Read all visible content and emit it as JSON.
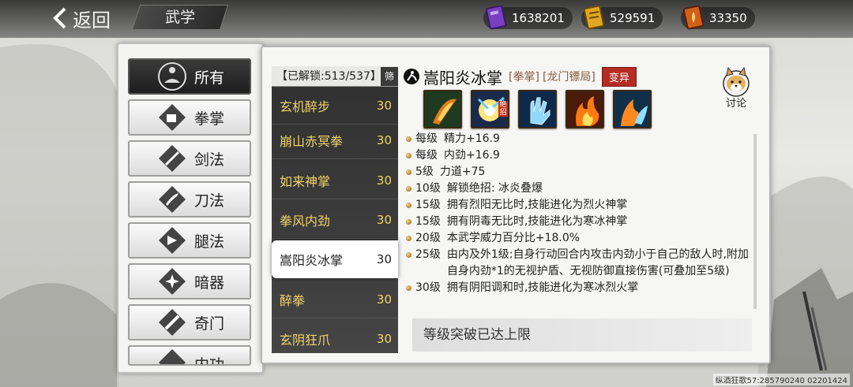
{
  "header": {
    "back_label": "返回",
    "section_title": "武学",
    "currencies": [
      {
        "icon": "purple-book-icon",
        "value": "1638201",
        "color": "#7a3fc0"
      },
      {
        "icon": "gold-scroll-icon",
        "value": "529591",
        "color": "#e0a820"
      },
      {
        "icon": "orange-scroll-icon",
        "value": "33350",
        "color": "#d0601a"
      }
    ]
  },
  "categories": [
    {
      "label": "所有",
      "icon": "meditation-icon",
      "active": true
    },
    {
      "label": "拳掌",
      "icon": "fist-icon",
      "active": false
    },
    {
      "label": "剑法",
      "icon": "sword-icon",
      "active": false
    },
    {
      "label": "刀法",
      "icon": "blade-icon",
      "active": false
    },
    {
      "label": "腿法",
      "icon": "kick-icon",
      "active": false
    },
    {
      "label": "暗器",
      "icon": "shuriken-icon",
      "active": false
    },
    {
      "label": "奇门",
      "icon": "staff-icon",
      "active": false
    },
    {
      "label": "内功",
      "icon": "inner-power-icon",
      "active": false
    }
  ],
  "skill_list": {
    "unlock_label": "【已解锁:513/537】",
    "filter_label": "筛",
    "items": [
      {
        "name": "玄机醉步",
        "level": "30"
      },
      {
        "name": "崩山赤冥拳",
        "level": "30"
      },
      {
        "name": "如来神掌",
        "level": "30"
      },
      {
        "name": "拳风内劲",
        "level": "30"
      },
      {
        "name": "嵩阳炎冰掌",
        "level": "30",
        "selected": true
      },
      {
        "name": "醉拳",
        "level": "30"
      },
      {
        "name": "玄阴狂爪",
        "level": "30"
      }
    ]
  },
  "detail": {
    "name": "嵩阳炎冰掌",
    "tag_type": "[拳掌]",
    "tag_source": "[龙门镖局]",
    "badge": "变异",
    "discuss_label": "讨论",
    "icons": [
      "fire-fist-icon",
      "ultimate-burst-icon",
      "ice-palm-icon",
      "flame-fist-icon",
      "fire-ice-icon"
    ],
    "ultimate_mark": "绝招",
    "effects": [
      {
        "level": "每级",
        "text": "精力+16.9"
      },
      {
        "level": "每级",
        "text": "内劲+16.9"
      },
      {
        "level": "5级",
        "text": "力道+75"
      },
      {
        "level": "10级",
        "text": "解锁绝招:  冰炎叠爆"
      },
      {
        "level": "15级",
        "text": "拥有烈阳无比时,技能进化为烈火神掌"
      },
      {
        "level": "15级",
        "text": "拥有阴毒无比时,技能进化为寒冰神掌"
      },
      {
        "level": "20级",
        "text": "本武学威力百分比+18.0%"
      },
      {
        "level": "25级",
        "text": "由内及外1级:自身行动回合内攻击内劲小于自己的敌人时,附加自身内劲*1的无视护盾、无视防御直接伤害(可叠加至5级)"
      },
      {
        "level": "30级",
        "text": "拥有阴阳调和时,技能进化为寒冰烈火掌"
      }
    ],
    "limit_text": "等级突破已达上限"
  },
  "watermark": "纵酒狂歌57:285790240 02201424"
}
